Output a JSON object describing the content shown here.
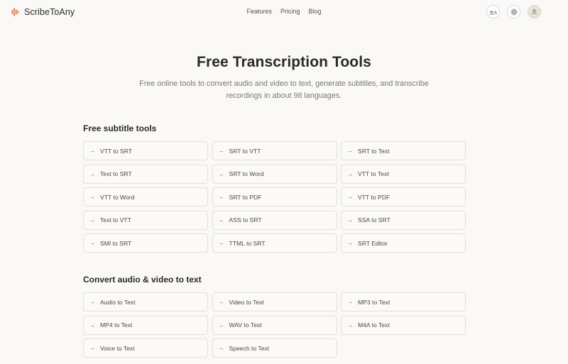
{
  "header": {
    "brand": "ScribeToAny",
    "nav": [
      "Features",
      "Pricing",
      "Blog"
    ],
    "icons": {
      "translate": "translate-icon",
      "theme": "sun-icon",
      "user": "user-icon"
    },
    "translate_glyph": "文A"
  },
  "hero": {
    "title": "Free Transcription Tools",
    "subtitle": "Free online tools to convert audio and video to text, generate subtitles, and transcribe recordings in about 98 languages."
  },
  "sections": [
    {
      "title": "Free subtitle tools",
      "tools": [
        "VTT to SRT",
        "SRT to VTT",
        "SRT to Text",
        "Text to SRT",
        "SRT to Word",
        "VTT to Text",
        "VTT to Word",
        "SRT to PDF",
        "VTT to PDF",
        "Text to VTT",
        "ASS to SRT",
        "SSA to SRT",
        "SMI to SRT",
        "TTML to SRT",
        "SRT Editor"
      ]
    },
    {
      "title": "Convert audio & video to text",
      "tools": [
        "Audio to Text",
        "Video to Text",
        "MP3 to Text",
        "MP4 to Text",
        "WAV to Text",
        "M4A to Text",
        "Voice to Text",
        "Speech to Text"
      ]
    }
  ],
  "colors": {
    "background": "#faf9f7",
    "brand_accent": "#e36b4f",
    "card_border": "#e3e0da"
  }
}
